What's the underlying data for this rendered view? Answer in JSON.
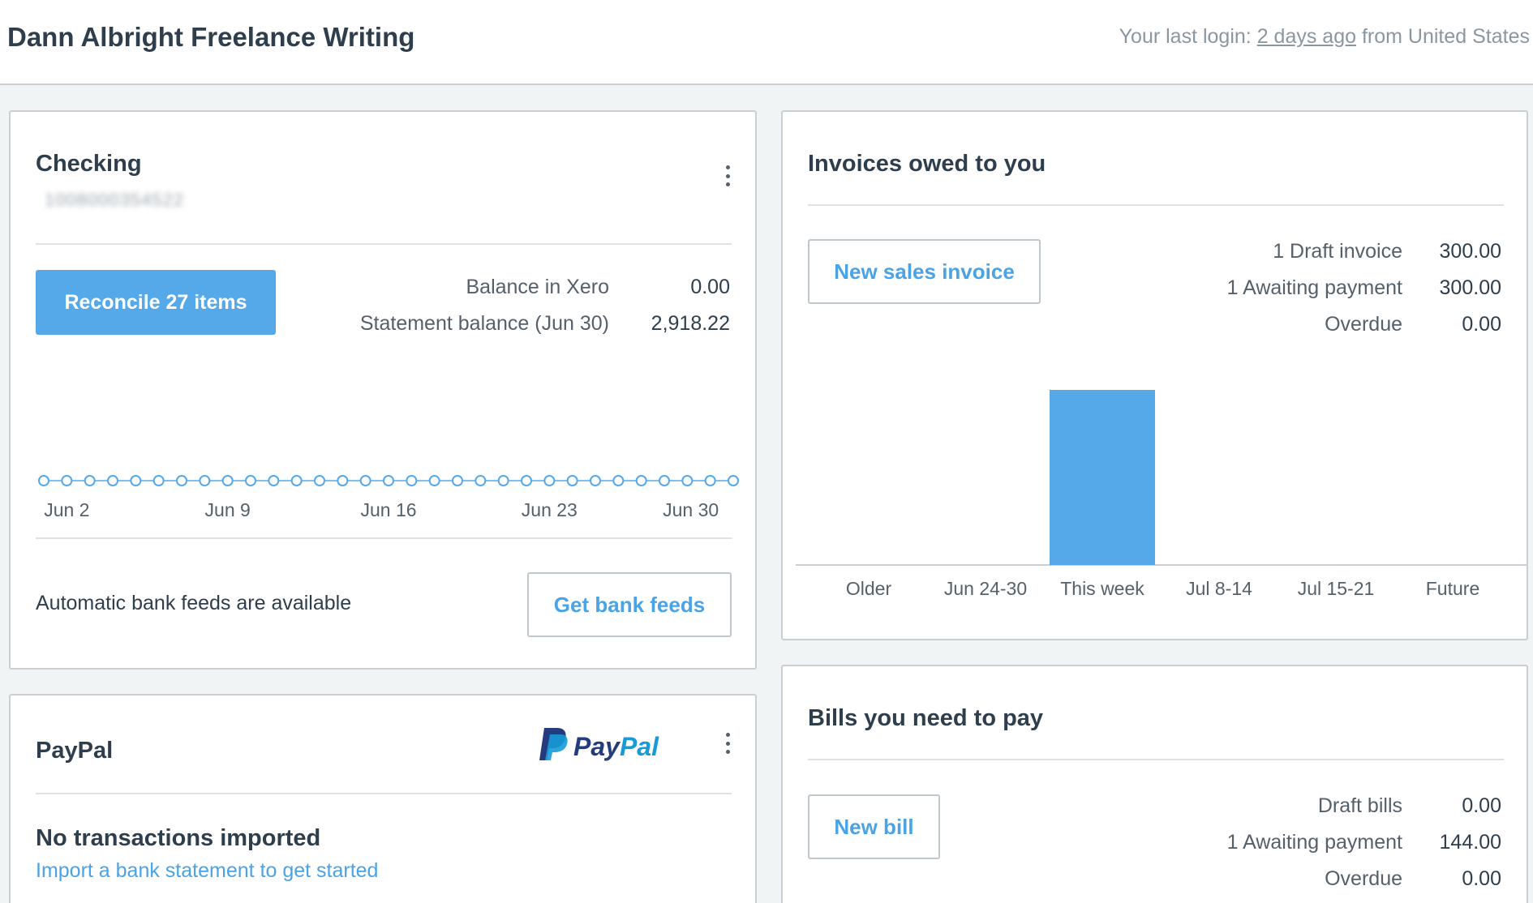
{
  "header": {
    "org_name": "Dann Albright Freelance Writing",
    "last_login_prefix": "Your last login:",
    "last_login_link": "2 days ago",
    "last_login_suffix": "from United States"
  },
  "checking": {
    "title": "Checking",
    "account_number": "1008000354522",
    "reconcile_button": "Reconcile 27 items",
    "balance_in_xero_label": "Balance in Xero",
    "balance_in_xero_value": "0.00",
    "statement_balance_label": "Statement balance (Jun 30)",
    "statement_balance_value": "2,918.22",
    "feeds_text": "Automatic bank feeds are available",
    "feeds_button": "Get bank feeds"
  },
  "paypal": {
    "title": "PayPal",
    "logo_text": "PayPal",
    "no_tx_title": "No transactions imported",
    "import_link": "Import a bank statement to get started"
  },
  "invoices": {
    "title": "Invoices owed to you",
    "new_button": "New sales invoice",
    "rows": [
      {
        "label": "1 Draft invoice",
        "value": "300.00"
      },
      {
        "label": "1 Awaiting payment",
        "value": "300.00"
      },
      {
        "label": "Overdue",
        "value": "0.00"
      }
    ]
  },
  "bills": {
    "title": "Bills you need to pay",
    "new_button": "New bill",
    "rows": [
      {
        "label": "Draft bills",
        "value": "0.00"
      },
      {
        "label": "1 Awaiting payment",
        "value": "144.00"
      },
      {
        "label": "Overdue",
        "value": "0.00"
      }
    ]
  },
  "colors": {
    "accent": "#55a9e8",
    "link": "#4aa3e4",
    "paypal_dark": "#253b80",
    "paypal_light": "#179bd7"
  },
  "chart_data": [
    {
      "type": "line",
      "x": [
        "Jun 1",
        "Jun 2",
        "Jun 3",
        "Jun 4",
        "Jun 5",
        "Jun 6",
        "Jun 7",
        "Jun 8",
        "Jun 9",
        "Jun 10",
        "Jun 11",
        "Jun 12",
        "Jun 13",
        "Jun 14",
        "Jun 15",
        "Jun 16",
        "Jun 17",
        "Jun 18",
        "Jun 19",
        "Jun 20",
        "Jun 21",
        "Jun 22",
        "Jun 23",
        "Jun 24",
        "Jun 25",
        "Jun 26",
        "Jun 27",
        "Jun 28",
        "Jun 29",
        "Jun 30",
        "Jul 1"
      ],
      "values": [
        0,
        0,
        0,
        0,
        0,
        0,
        0,
        0,
        0,
        0,
        0,
        0,
        0,
        0,
        0,
        0,
        0,
        0,
        0,
        0,
        0,
        0,
        0,
        0,
        0,
        0,
        0,
        0,
        0,
        0,
        0
      ],
      "tick_labels": [
        "Jun 2",
        "Jun 9",
        "Jun 16",
        "Jun 23",
        "Jun 30"
      ],
      "grid": false
    },
    {
      "type": "bar",
      "categories": [
        "Older",
        "Jun 24-30",
        "This week",
        "Jul 8-14",
        "Jul 15-21",
        "Future"
      ],
      "values": [
        0,
        0,
        300,
        0,
        0,
        0
      ],
      "ylim": [
        0,
        300
      ],
      "grid": false
    }
  ]
}
